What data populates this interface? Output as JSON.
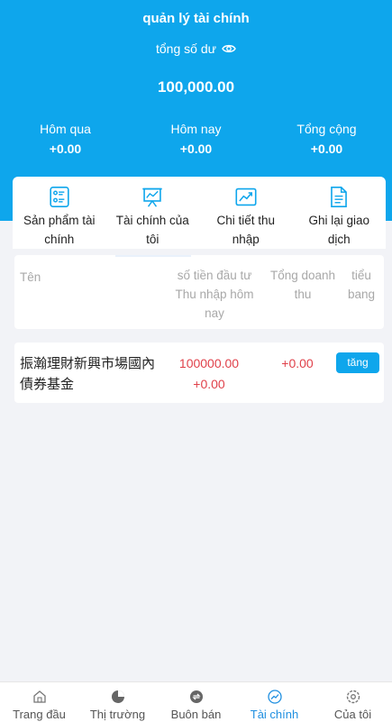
{
  "header": {
    "title": "quản lý tài chính",
    "balance_label": "tổng số dư",
    "balance_value": "100,000.00"
  },
  "stats": [
    {
      "label": "Hôm qua",
      "value": "+0.00"
    },
    {
      "label": "Hôm nay",
      "value": "+0.00"
    },
    {
      "label": "Tổng cộng",
      "value": "+0.00"
    }
  ],
  "menu": [
    {
      "label": "Sản phẩm tài chính",
      "icon": "product-list-icon"
    },
    {
      "label": "Tài chính của tôi",
      "icon": "presentation-chart-icon"
    },
    {
      "label": "Chi tiết thu nhập",
      "icon": "trend-up-icon"
    },
    {
      "label": "Ghi lại giao dịch",
      "icon": "document-icon"
    }
  ],
  "table": {
    "col_name": "Tên",
    "col_amount": "số tiền đầu tư Thu nhập hôm nay",
    "col_total": "Tổng doanh thu",
    "col_detail": "tiểu bang"
  },
  "rows": [
    {
      "name": "振瀚理財新興市場國內債券基金",
      "amount": "100000.00",
      "today": "+0.00",
      "total": "+0.00",
      "button": "tăng"
    }
  ],
  "nav": [
    {
      "label": "Trang đầu",
      "icon": "home-icon",
      "active": false
    },
    {
      "label": "Thị trường",
      "icon": "pie-chart-icon",
      "active": false
    },
    {
      "label": "Buôn bán",
      "icon": "exchange-icon",
      "active": false
    },
    {
      "label": "Tài chính",
      "icon": "finance-chart-icon",
      "active": true
    },
    {
      "label": "Của tôi",
      "icon": "settings-icon",
      "active": false
    }
  ],
  "colors": {
    "primary": "#0ea6ec",
    "profit": "#e0414a",
    "active_nav": "#1f8fe0"
  }
}
